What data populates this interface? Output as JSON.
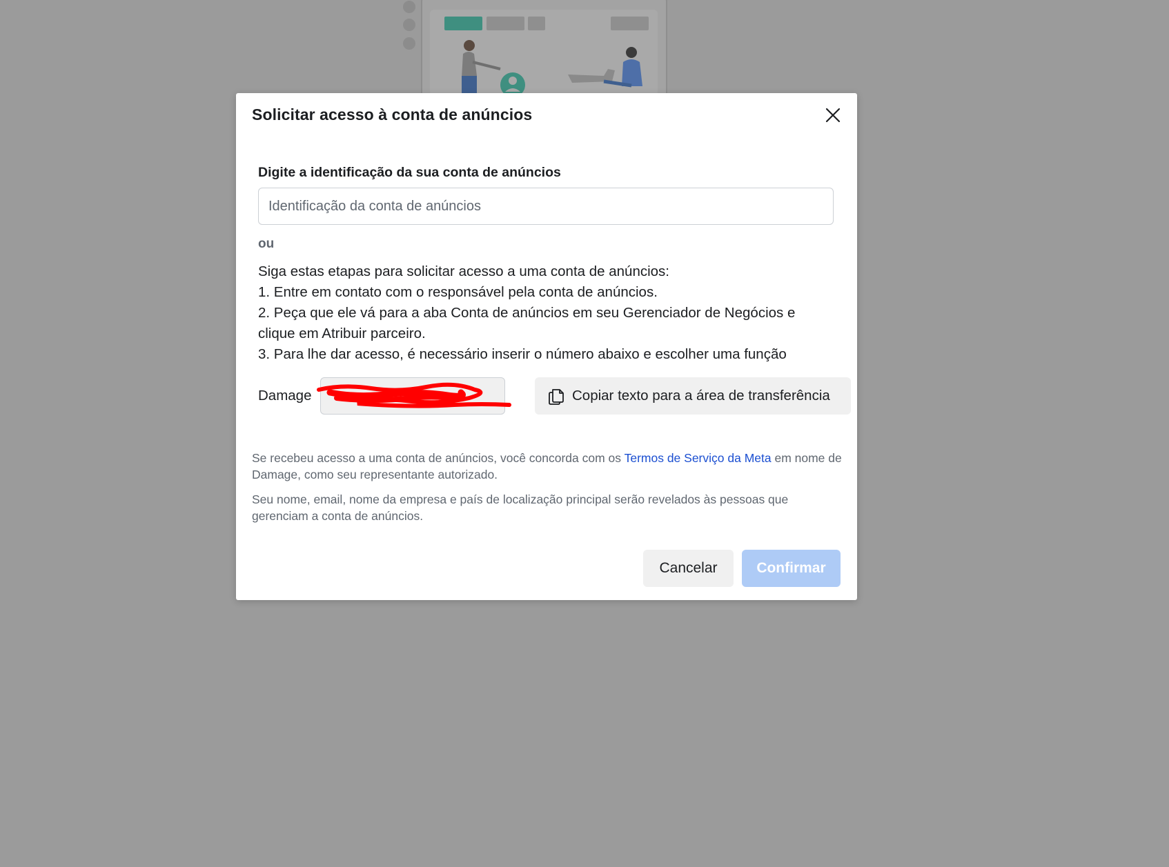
{
  "modal": {
    "title": "Solicitar acesso à conta de anúncios",
    "field_label": "Digite a identificação da sua conta de anúncios",
    "input_placeholder": "Identificação da conta de anúncios",
    "input_value": "",
    "or_label": "ou",
    "steps": [
      "Siga estas etapas para solicitar acesso a uma conta de anúncios:",
      "1. Entre em contato com o responsável pela conta de anúncios.",
      "2. Peça que ele vá para a aba Conta de anúncios em seu Gerenciador de Negócios e",
      "clique em Atribuir parceiro.",
      "3. Para lhe dar acesso, é necessário inserir o número abaixo e escolher uma função"
    ],
    "business_name": "Damage",
    "business_id": "",
    "copy_button_label": "Copiar texto para a área de transferência",
    "legal": {
      "p1_before": "Se recebeu acesso a uma conta de anúncios, você concorda com os ",
      "p1_link": "Termos de Serviço da Meta",
      "p1_after": " em nome de Damage, como seu representante autorizado.",
      "p2": "Seu nome, email, nome da empresa e país de localização principal serão revelados às pessoas que gerenciam a conta de anúncios."
    },
    "cancel_label": "Cancelar",
    "confirm_label": "Confirmar"
  },
  "icons": {
    "close": "close-icon",
    "copy": "copy-icon"
  },
  "colors": {
    "overlay": "#9b9b9b",
    "link": "#1b4fd1",
    "confirm_disabled": "#aecbf6",
    "secondary_button": "#f0f0f0",
    "redaction": "#ff0000"
  }
}
